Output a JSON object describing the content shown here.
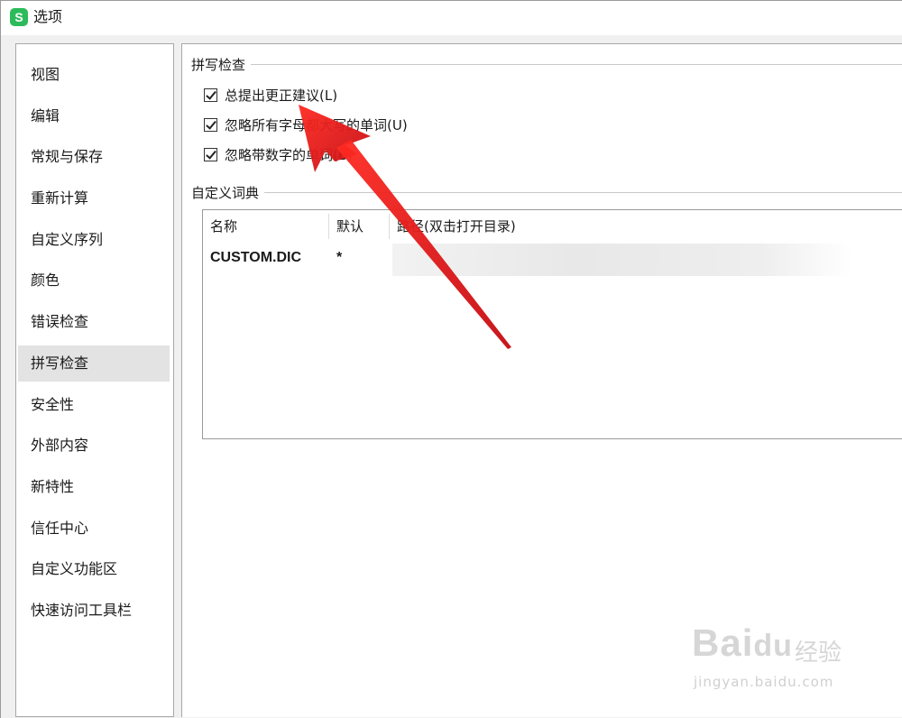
{
  "window": {
    "title": "选项",
    "app_icon_letter": "S"
  },
  "sidebar": {
    "items": [
      {
        "label": "视图",
        "active": false
      },
      {
        "label": "编辑",
        "active": false
      },
      {
        "label": "常规与保存",
        "active": false
      },
      {
        "label": "重新计算",
        "active": false
      },
      {
        "label": "自定义序列",
        "active": false
      },
      {
        "label": "颜色",
        "active": false
      },
      {
        "label": "错误检查",
        "active": false
      },
      {
        "label": "拼写检查",
        "active": true
      },
      {
        "label": "安全性",
        "active": false
      },
      {
        "label": "外部内容",
        "active": false
      },
      {
        "label": "新特性",
        "active": false
      },
      {
        "label": "信任中心",
        "active": false
      },
      {
        "label": "自定义功能区",
        "active": false
      },
      {
        "label": "快速访问工具栏",
        "active": false
      }
    ]
  },
  "spellcheck": {
    "group_title": "拼写检查",
    "options": [
      {
        "label": "总提出更正建议(L)",
        "checked": true
      },
      {
        "label": "忽略所有字母都大写的单词(U)",
        "checked": true
      },
      {
        "label": "忽略带数字的单词(B)",
        "checked": true
      }
    ]
  },
  "dictionary": {
    "group_title": "自定义词典",
    "columns": [
      "名称",
      "默认",
      "路径(双击打开目录)"
    ],
    "rows": [
      {
        "name": "CUSTOM.DIC",
        "default": "*",
        "path": ""
      }
    ]
  },
  "watermark": {
    "brand": "Bai",
    "brand_du": "du",
    "cn": "经验",
    "url": "jingyan.baidu.com"
  },
  "colors": {
    "accent_active_item": "#e3e3e3",
    "app_icon": "#2cbb5b",
    "annotation_arrow": "#e8141a"
  }
}
